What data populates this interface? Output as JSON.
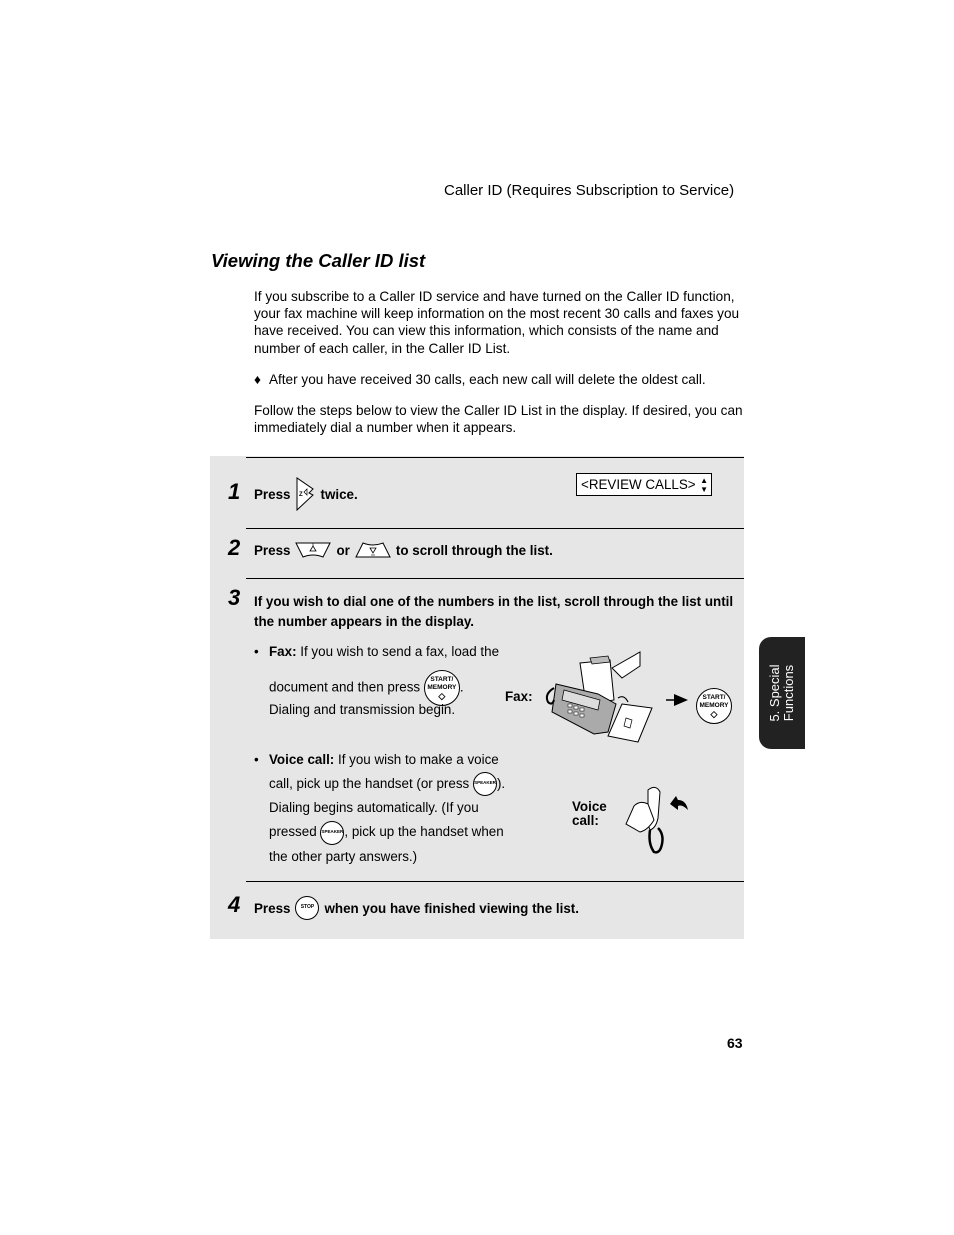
{
  "header": {
    "running_head": "Caller ID (Requires Subscription to Service)"
  },
  "section": {
    "title": "Viewing the Caller ID list",
    "intro_paragraph": "If you subscribe to a Caller ID service and have turned on the Caller ID function, your fax machine will keep information on the most recent 30 calls and faxes you have received. You can view this information, which consists of the name and number of each caller, in the Caller ID List.",
    "note_bullet": "♦",
    "note": "After you have received 30 calls, each new call will delete the oldest call.",
    "follow_paragraph": "Follow the steps below to view the Caller ID List in the display. If desired, you can immediately dial a number when it appears."
  },
  "steps": [
    {
      "number": "1",
      "press": "Press",
      "key_icon": "function-key",
      "after": "twice.",
      "display": {
        "text": "<REVIEW CALLS>",
        "arrows_up": "▲",
        "arrows_down": "▼"
      }
    },
    {
      "number": "2",
      "press": "Press",
      "key1_icon": "scroll-up-key",
      "or": "or",
      "key2_icon": "scroll-down-key",
      "after": "to scroll through the list."
    },
    {
      "number": "3",
      "text": "If you wish to dial one of the numbers in the list, scroll through the list until the number appears in the display.",
      "fax": {
        "label": "Fax:",
        "line1": " If you wish to send a fax, load the",
        "line2_before": "document and then press",
        "line2_after": ".",
        "line3": "Dialing and transmission begin.",
        "illustration_label": "Fax:",
        "button_line1": "START/",
        "button_line2": "MEMORY"
      },
      "voice": {
        "label": "Voice call:",
        "line1": " If you wish to make a voice",
        "line2_before": "call, pick up the handset (or press",
        "line2_after": ").",
        "line3": "Dialing begins automatically. (If you",
        "line4_before": "pressed",
        "line4_after": ", pick up the handset when",
        "line5": "the other party answers.)",
        "speaker_key": "SPEAKER",
        "illustration_label_1": "Voice",
        "illustration_label_2": "call:"
      }
    },
    {
      "number": "4",
      "press": "Press",
      "key_label": "STOP",
      "after": "when you have finished viewing the list."
    }
  ],
  "side_tab": {
    "line1": "5. Special",
    "line2": "Functions"
  },
  "footer": {
    "page_number": "63"
  }
}
